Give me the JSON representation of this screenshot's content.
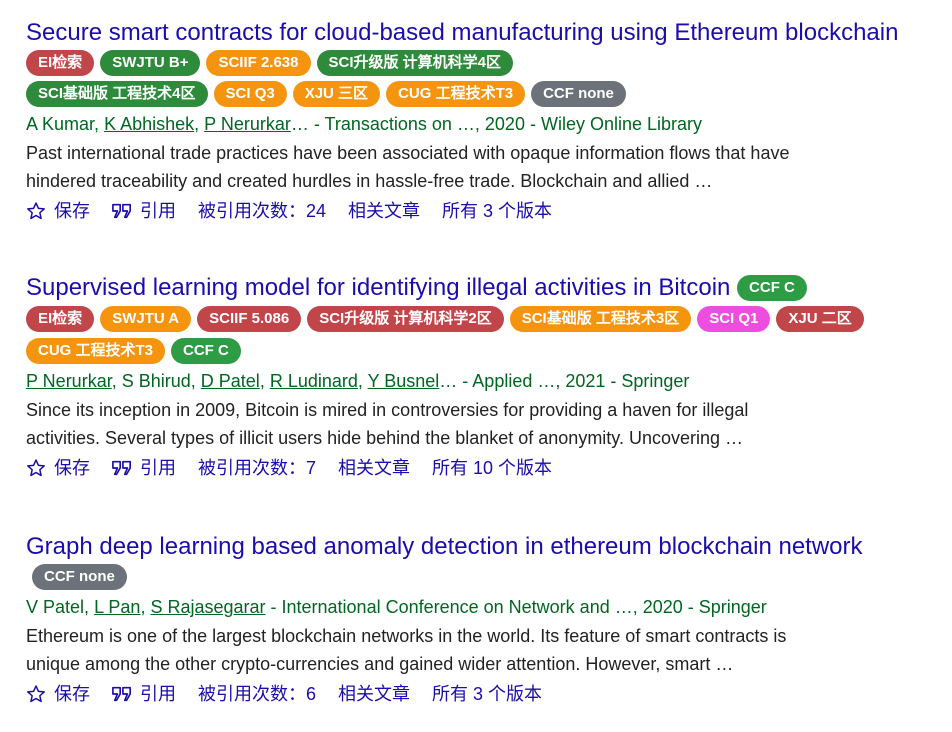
{
  "results": [
    {
      "title": "Secure smart contracts for cloud-based manufacturing using Ethereum blockchain",
      "badges_inline": [
        {
          "label": "EI检索",
          "color": "#c0464a"
        },
        {
          "label": "SWJTU B+",
          "color": "#2e8b3c"
        },
        {
          "label": "SCIIF 2.638",
          "color": "#f5940f"
        },
        {
          "label": "SCI升级版 计算机科学4区",
          "color": "#2e8b3c"
        }
      ],
      "badges_row": [
        {
          "label": "SCI基础版 工程技术4区",
          "color": "#2e8b3c"
        },
        {
          "label": "SCI Q3",
          "color": "#f5940f"
        },
        {
          "label": "XJU 三区",
          "color": "#f5940f"
        },
        {
          "label": "CUG 工程技术T3",
          "color": "#f5940f"
        },
        {
          "label": "CCF none",
          "color": "#6b7279"
        }
      ],
      "authors": [
        {
          "name": "A Kumar",
          "link": false
        },
        {
          "name": "K Abhishek",
          "link": true
        },
        {
          "name": "P Nerurkar",
          "link": true
        }
      ],
      "authors_ellipsis": "…",
      "venue": " - Transactions on …, 2020 - Wiley Online Library",
      "snippet": "Past international trade practices have been associated with opaque information flows that have hindered traceability and created hurdles in hassle-free trade. Blockchain and allied …",
      "actions": {
        "save": "保存",
        "cite": "引用",
        "cited_by": "被引用次数：24",
        "related": "相关文章",
        "versions": "所有 3 个版本"
      }
    },
    {
      "title": "Supervised learning model for identifying illegal activities in Bitcoin",
      "badges_inline": [
        {
          "label": "CCF C",
          "color": "#2e9c45"
        }
      ],
      "badges_row": [
        {
          "label": "EI检索",
          "color": "#c0464a"
        },
        {
          "label": "SWJTU A",
          "color": "#f5940f"
        },
        {
          "label": "SCIIF 5.086",
          "color": "#c0464a"
        },
        {
          "label": "SCI升级版 计算机科学2区",
          "color": "#c0464a"
        },
        {
          "label": "SCI基础版 工程技术3区",
          "color": "#f5940f"
        },
        {
          "label": "SCI Q1",
          "color": "#ee4ee0"
        },
        {
          "label": "XJU 二区",
          "color": "#c0464a"
        },
        {
          "label": "CUG 工程技术T3",
          "color": "#f5940f"
        },
        {
          "label": "CCF C",
          "color": "#2e9c45"
        }
      ],
      "authors": [
        {
          "name": "P Nerurkar",
          "link": true
        },
        {
          "name": "S Bhirud",
          "link": false
        },
        {
          "name": "D Patel",
          "link": true
        },
        {
          "name": "R Ludinard",
          "link": true
        },
        {
          "name": "Y Busnel",
          "link": true
        }
      ],
      "authors_ellipsis": "…",
      "venue": " - Applied …, 2021 - Springer",
      "snippet": "Since its inception in 2009, Bitcoin is mired in controversies for providing a haven for illegal activities. Several types of illicit users hide behind the blanket of anonymity. Uncovering …",
      "actions": {
        "save": "保存",
        "cite": "引用",
        "cited_by": "被引用次数：7",
        "related": "相关文章",
        "versions": "所有 10 个版本"
      }
    },
    {
      "title": "Graph deep learning based anomaly detection in ethereum blockchain network",
      "badges_inline": [],
      "badges_row": [
        {
          "label": "CCF none",
          "color": "#6b7279"
        }
      ],
      "authors": [
        {
          "name": "V Patel",
          "link": false
        },
        {
          "name": "L Pan",
          "link": true
        },
        {
          "name": "S Rajasegarar",
          "link": true
        }
      ],
      "authors_ellipsis": "",
      "venue": " - International Conference on Network and …, 2020 - Springer",
      "snippet": "Ethereum is one of the largest blockchain networks in the world. Its feature of smart contracts is unique among the other crypto-currencies and gained wider attention. However, smart …",
      "actions": {
        "save": "保存",
        "cite": "引用",
        "cited_by": "被引用次数：6",
        "related": "相关文章",
        "versions": "所有 3 个版本"
      }
    }
  ],
  "icons": {
    "save": "star-outline-icon",
    "cite": "quote-icon"
  },
  "colors": {
    "title": "#1a0dab",
    "meta": "#006621",
    "snippet": "#222222"
  }
}
